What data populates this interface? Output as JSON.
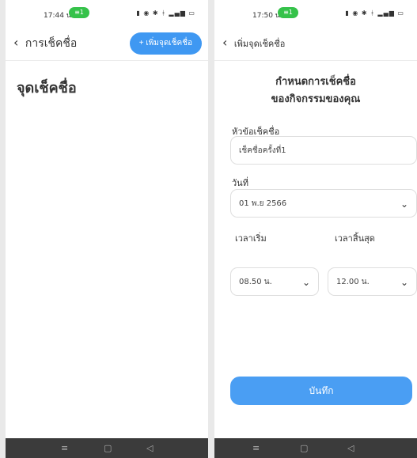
{
  "screen1": {
    "status": {
      "time": "17:44 น.",
      "badge": "1"
    },
    "back_label": "การเช็คชื่อ",
    "add_button": "+ เพิ่มจุดเช็คชื่อ",
    "page_title": "จุดเช็คชื่อ"
  },
  "screen2": {
    "status": {
      "time": "17:50 น.",
      "badge": "1"
    },
    "back_label": "เพิ่มจุดเช็คชื่อ",
    "form_title_line1": "กำหนดการเช็คชื่อ",
    "form_title_line2": "ของกิจกรรมของคุณ",
    "topic_label": "หัวข้อเช็คชื่อ",
    "topic_value": "เช็คชื่อครั้งที่1",
    "date_label": "วันที่",
    "date_value": "01 พ.ย 2566",
    "start_label": "เวลาเริ่ม",
    "start_value": "08.50 น.",
    "end_label": "เวลาสิ้นสุด",
    "end_value": "12.00 น.",
    "save_button": "บันทึก"
  },
  "colors": {
    "accent": "#3f98f2",
    "badge": "#35c24a",
    "navbar": "#3b3b3b"
  },
  "icons": {
    "back": "chevron-left-icon",
    "dropdown": "chevron-down-icon"
  }
}
